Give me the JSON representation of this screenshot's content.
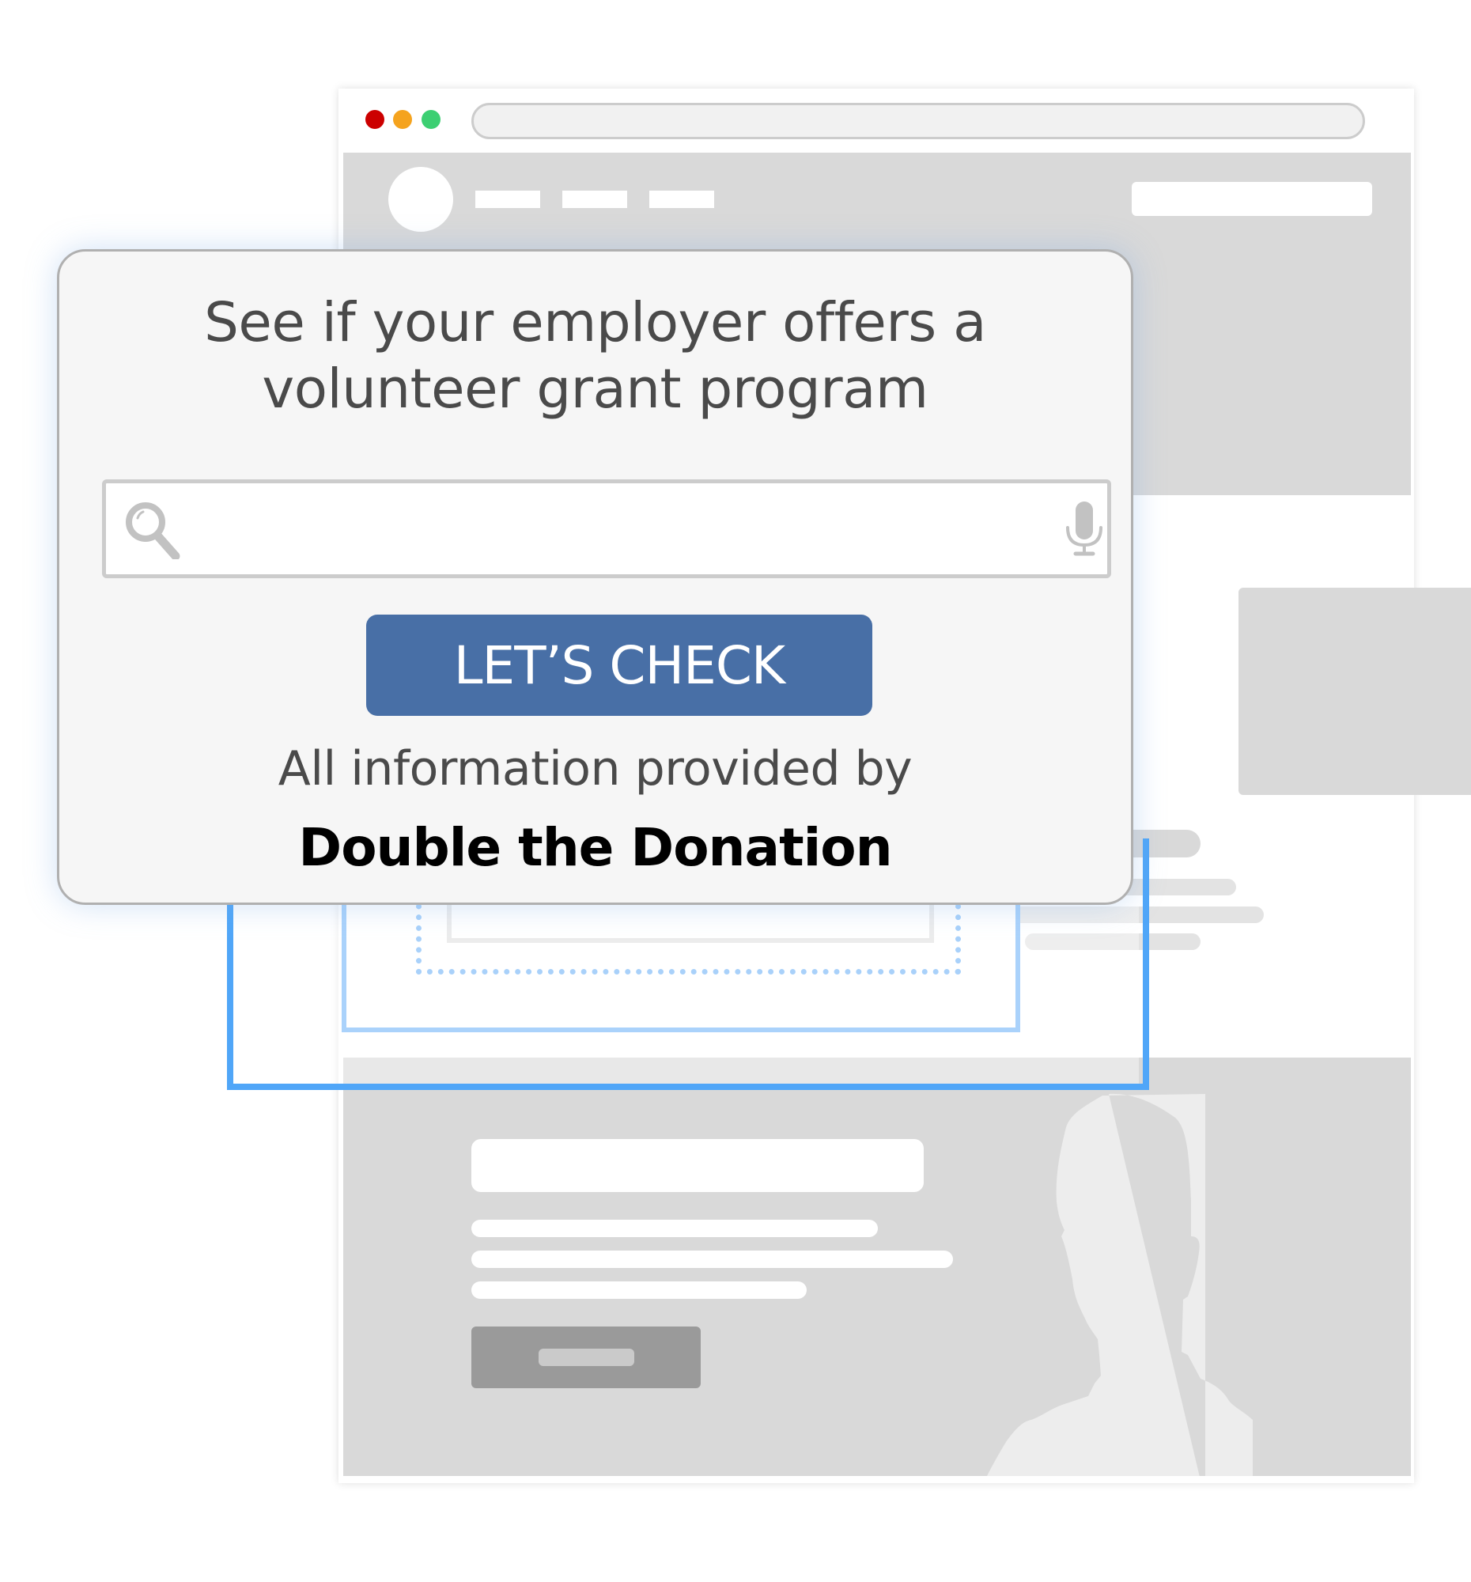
{
  "browser": {
    "window_controls": [
      {
        "name": "close",
        "color": "#cc0000"
      },
      {
        "name": "minimize",
        "color": "#f5a31e"
      },
      {
        "name": "maximize",
        "color": "#3ccf72"
      }
    ],
    "address_bar": ""
  },
  "widget": {
    "title": "See if your employer offers a volunteer grant program",
    "title_lines": [
      "See if your employer offers a",
      "volunteer grant program"
    ],
    "search": {
      "value": "",
      "placeholder": "",
      "left_icon": "search-icon",
      "right_icon": "microphone-icon"
    },
    "button_label": "LET’S CHECK",
    "button_color": "#486fa6",
    "provided_by": "All information provided by",
    "provider": "Double the Donation"
  },
  "colors": {
    "frame_outer": "#50a6f8",
    "frame_mid": "#aad2fb",
    "placeholder_gray": "#d9d9d9"
  }
}
